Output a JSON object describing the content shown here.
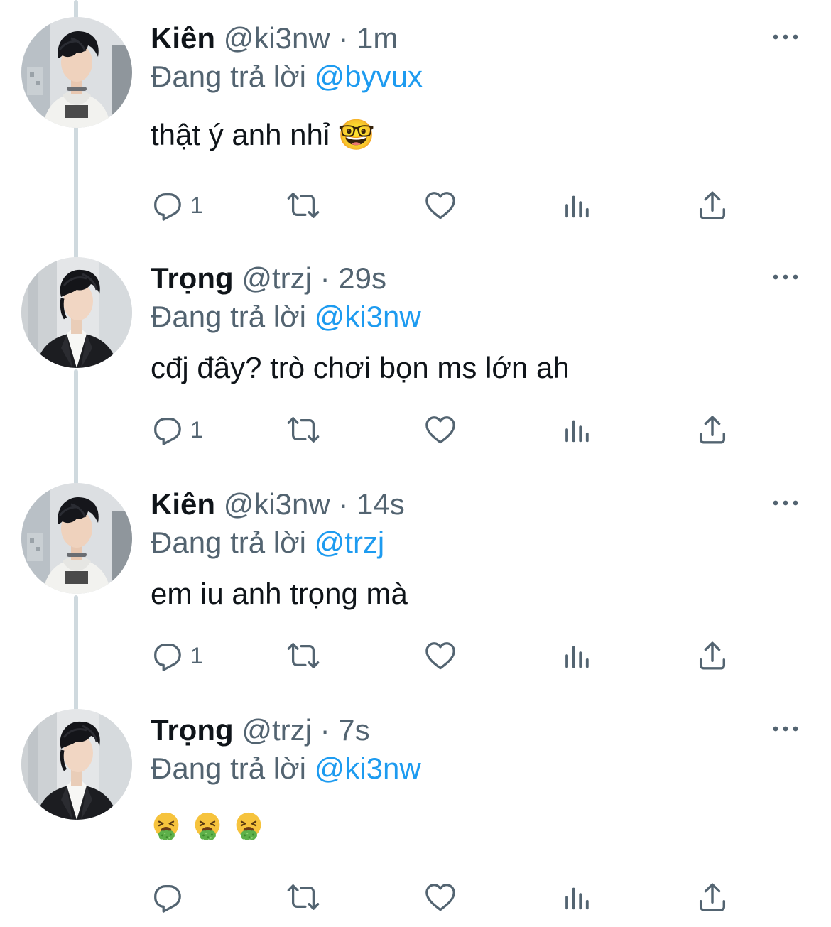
{
  "tweets": [
    {
      "name": "Kiên",
      "handle": "@ki3nw",
      "separator": "·",
      "time": "1m",
      "replying_prefix": "Đang trả lời",
      "replying_to": "@byvux",
      "text": "thật ý anh nhỉ 🤓",
      "reply_count": "1",
      "avatar": "kien-avatar"
    },
    {
      "name": "Trọng",
      "handle": "@trzj",
      "separator": "·",
      "time": "29s",
      "replying_prefix": "Đang trả lời",
      "replying_to": "@ki3nw",
      "text": "cđj đây? trò chơi bọn ms lớn ah",
      "reply_count": "1",
      "avatar": "trong-avatar"
    },
    {
      "name": "Kiên",
      "handle": "@ki3nw",
      "separator": "·",
      "time": "14s",
      "replying_prefix": "Đang trả lời",
      "replying_to": "@trzj",
      "text": "em iu anh trọng mà",
      "reply_count": "1",
      "avatar": "kien-avatar"
    },
    {
      "name": "Trọng",
      "handle": "@trzj",
      "separator": "·",
      "time": "7s",
      "replying_prefix": "Đang trả lời",
      "replying_to": "@ki3nw",
      "text": "",
      "emojis": [
        "vomiting-face",
        "vomiting-face",
        "vomiting-face"
      ],
      "reply_count": "",
      "avatar": "trong-avatar"
    }
  ],
  "colors": {
    "text_primary": "#0f1419",
    "text_secondary": "#536471",
    "link": "#1d9bf0",
    "thread_line": "#cfd9de"
  },
  "icons": [
    "reply-icon",
    "retweet-icon",
    "like-icon",
    "stats-icon",
    "share-icon",
    "more-icon"
  ]
}
